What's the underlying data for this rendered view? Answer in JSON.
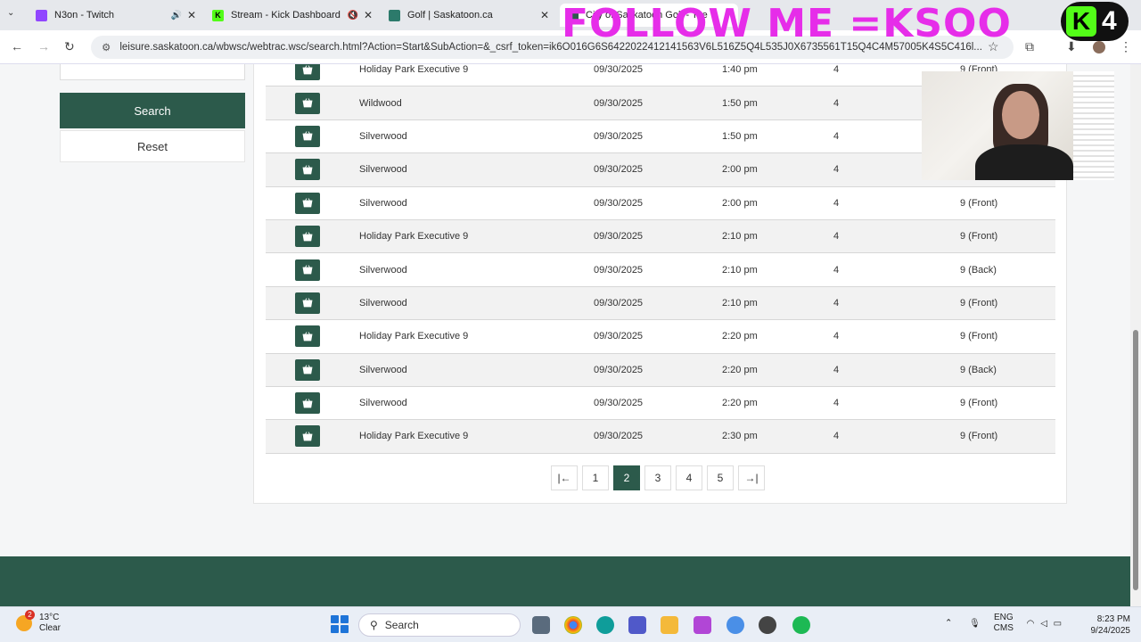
{
  "browser": {
    "tabs": [
      {
        "title": "N3on - Twitch",
        "favicon_color": "#9146ff",
        "sound": "🔊"
      },
      {
        "title": "Stream - Kick Dashboard",
        "favicon_color": "#53fc18",
        "sound": "🔇"
      },
      {
        "title": "Golf | Saskatoon.ca",
        "favicon_color": "#2c7a6b"
      },
      {
        "title": "City of Saskatoon Golf - Tee T",
        "favicon_color": "#2c5a4b"
      }
    ],
    "url": "leisure.saskatoon.ca/wbwsc/webtrac.wsc/search.html?Action=Start&SubAction=&_csrf_token=ik6O016G6S6422022412141563V6L516Z5Q4L535J0X6735561T15Q4C4M57005K4S5C416l..."
  },
  "overlay": {
    "text": "FOLLOW ME =KSOO",
    "badge_number": "4"
  },
  "sidebar": {
    "search_label": "Search",
    "reset_label": "Reset"
  },
  "results": {
    "rows": [
      {
        "course": "Holiday Park Executive 9",
        "date": "09/30/2025",
        "time": "1:40 pm",
        "players": "4",
        "holes": "9 (Front)"
      },
      {
        "course": "Wildwood",
        "date": "09/30/2025",
        "time": "1:50 pm",
        "players": "4",
        "holes": ""
      },
      {
        "course": "Silverwood",
        "date": "09/30/2025",
        "time": "1:50 pm",
        "players": "4",
        "holes": ""
      },
      {
        "course": "Silverwood",
        "date": "09/30/2025",
        "time": "2:00 pm",
        "players": "4",
        "holes": ""
      },
      {
        "course": "Silverwood",
        "date": "09/30/2025",
        "time": "2:00 pm",
        "players": "4",
        "holes": "9 (Front)"
      },
      {
        "course": "Holiday Park Executive 9",
        "date": "09/30/2025",
        "time": "2:10 pm",
        "players": "4",
        "holes": "9 (Front)"
      },
      {
        "course": "Silverwood",
        "date": "09/30/2025",
        "time": "2:10 pm",
        "players": "4",
        "holes": "9 (Back)"
      },
      {
        "course": "Silverwood",
        "date": "09/30/2025",
        "time": "2:10 pm",
        "players": "4",
        "holes": "9 (Front)"
      },
      {
        "course": "Holiday Park Executive 9",
        "date": "09/30/2025",
        "time": "2:20 pm",
        "players": "4",
        "holes": "9 (Front)"
      },
      {
        "course": "Silverwood",
        "date": "09/30/2025",
        "time": "2:20 pm",
        "players": "4",
        "holes": "9 (Back)"
      },
      {
        "course": "Silverwood",
        "date": "09/30/2025",
        "time": "2:20 pm",
        "players": "4",
        "holes": "9 (Front)"
      },
      {
        "course": "Holiday Park Executive 9",
        "date": "09/30/2025",
        "time": "2:30 pm",
        "players": "4",
        "holes": "9 (Front)"
      }
    ]
  },
  "pagination": {
    "first": "|←",
    "pages": [
      "1",
      "2",
      "3",
      "4",
      "5"
    ],
    "current": "2",
    "last": "→|"
  },
  "taskbar": {
    "weather_temp": "13°C",
    "weather_desc": "Clear",
    "notification_count": "2",
    "search_label": "Search",
    "lang_line1": "ENG",
    "lang_line2": "CMS",
    "time": "8:23 PM",
    "date": "9/24/2025"
  },
  "colors": {
    "brand": "#2c5a4b",
    "overlay": "#e62de9"
  }
}
